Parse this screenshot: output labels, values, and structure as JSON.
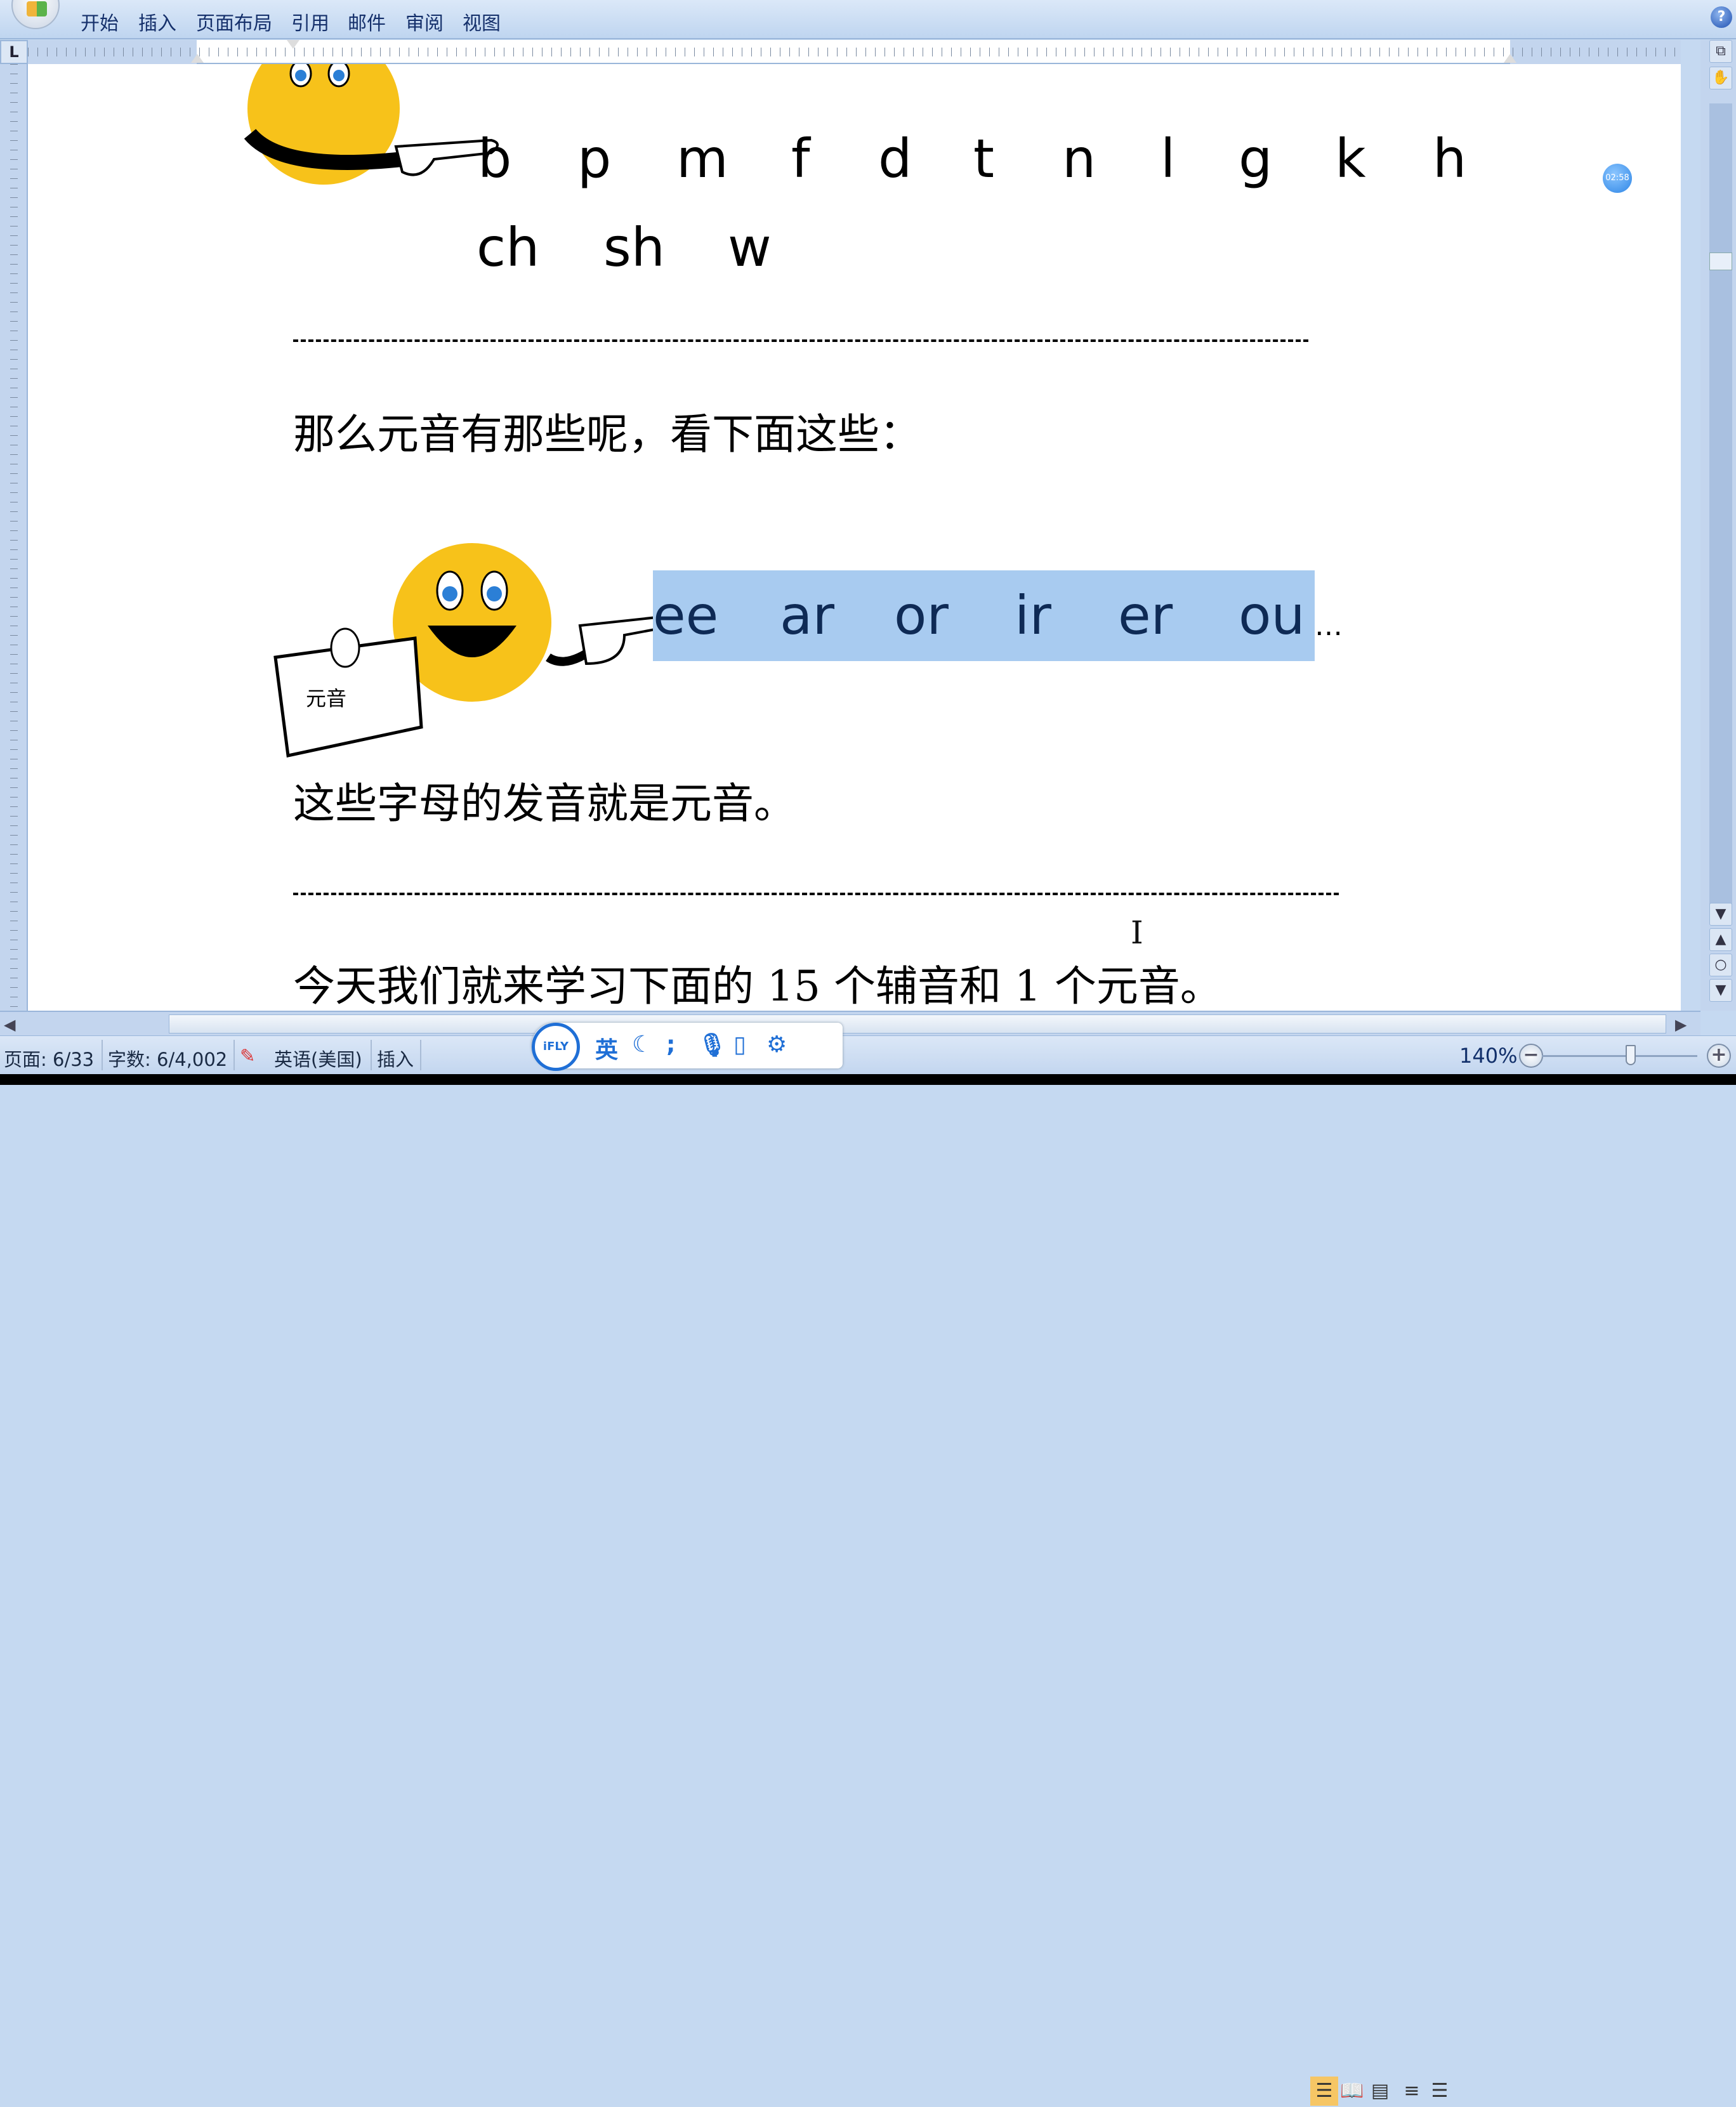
{
  "ribbon": {
    "tabs": [
      "开始",
      "插入",
      "页面布局",
      "引用",
      "邮件",
      "审阅",
      "视图"
    ],
    "help_icon": "?"
  },
  "ruler": {
    "tab_selector": "L"
  },
  "document": {
    "consonants_row1": [
      "b",
      "p",
      "m",
      "f",
      "d",
      "t",
      "n",
      "l",
      "g",
      "k",
      "h"
    ],
    "consonants_row2": [
      "ch",
      "sh",
      "w"
    ],
    "question": "那么元音有那些呢，看下面这些：",
    "card_label": "元音",
    "vowels": [
      "ee",
      "ar",
      "or",
      "ir",
      "er",
      "ou"
    ],
    "vowels_ellipsis": "…",
    "statement": "这些字母的发音就是元音。",
    "closing": "今天我们就来学习下面的 15 个辅音和 1 个元音。",
    "selection_color": "#a8cbf0"
  },
  "timer_bubble": "02:58",
  "status": {
    "page": "页面: 6/33",
    "words": "字数: 6/4,002",
    "language": "英语(美国)",
    "mode": "插入",
    "zoom": "140%"
  },
  "ifly_toolbar": {
    "logo": "iFLY",
    "lang": "英",
    "icons": [
      "moon-icon",
      "punctuation-icon",
      "microphone-icon",
      "keyboard-icon",
      "gear-icon"
    ]
  }
}
